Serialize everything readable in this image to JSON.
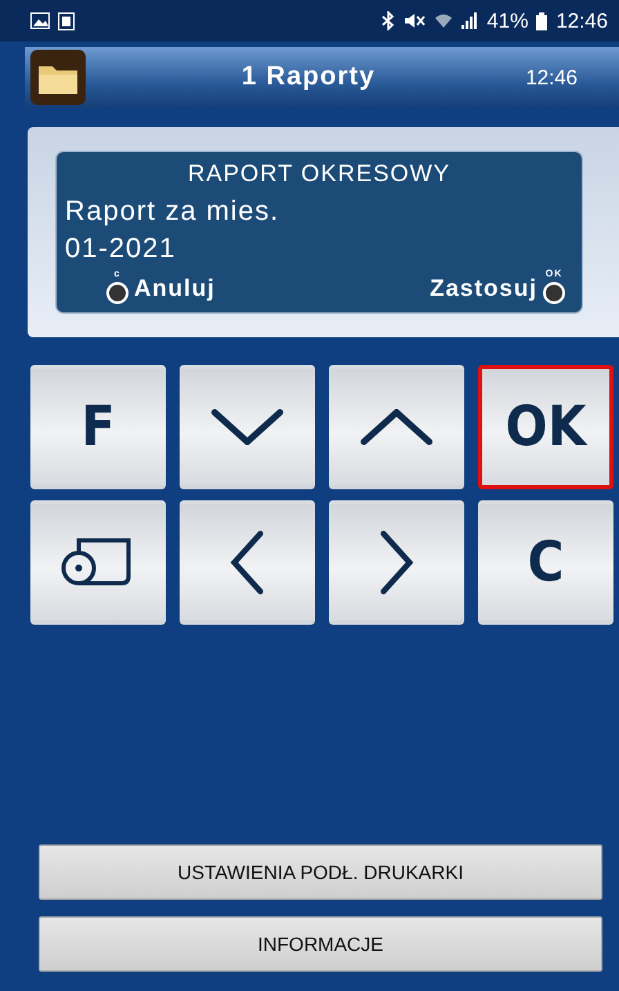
{
  "status_bar": {
    "battery": "41%",
    "time": "12:46"
  },
  "header": {
    "title": "1 Raporty",
    "time": "12:46"
  },
  "dialog": {
    "title": "RAPORT OKRESOWY",
    "lines": [
      "Raport za mies.",
      "01-2021"
    ],
    "actions": [
      {
        "kind": "icon-first",
        "label": "Anuluj",
        "key": "c"
      },
      {
        "kind": "icon-last",
        "label": "Zastosuj",
        "key": "OK"
      }
    ]
  },
  "keypad": [
    {
      "kind": "label",
      "label": "F",
      "selected": false
    },
    {
      "kind": "down",
      "selected": false
    },
    {
      "kind": "up",
      "selected": false
    },
    {
      "kind": "label",
      "label": "OK",
      "selected": true
    },
    {
      "kind": "roll",
      "selected": false
    },
    {
      "kind": "left",
      "selected": false
    },
    {
      "kind": "right",
      "selected": false
    },
    {
      "kind": "label",
      "label": "C",
      "selected": false
    }
  ],
  "buttons": [
    "USTAWIENIA PODŁ. DRUKARKI",
    "INFORMACJE"
  ]
}
